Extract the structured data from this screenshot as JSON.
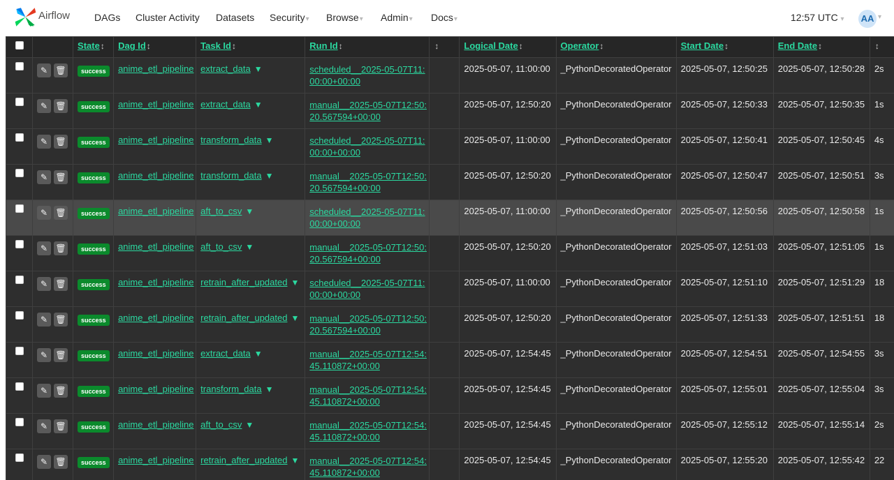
{
  "nav": {
    "brand": "Airflow",
    "items": [
      {
        "label": "DAGs",
        "dropdown": false
      },
      {
        "label": "Cluster Activity",
        "dropdown": false
      },
      {
        "label": "Datasets",
        "dropdown": false
      },
      {
        "label": "Security",
        "dropdown": true
      },
      {
        "label": "Browse",
        "dropdown": true
      },
      {
        "label": "Admin",
        "dropdown": true
      },
      {
        "label": "Docs",
        "dropdown": true
      }
    ],
    "clock": "12:57 UTC",
    "avatar": "AA"
  },
  "table": {
    "headers": {
      "state": "State",
      "dag_id": "Dag Id",
      "task_id": "Task Id",
      "run_id": "Run Id",
      "logical_date": "Logical Date",
      "operator": "Operator",
      "start_date": "Start Date",
      "end_date": "End Date"
    },
    "rows": [
      {
        "state": "success",
        "dag_id": "anime_etl_pipeline",
        "task_id": "extract_data",
        "run_id": "scheduled__2025-05-07T11:00:00+00:00",
        "logical_date": "2025-05-07, 11:00:00",
        "operator": "_PythonDecoratedOperator",
        "start_date": "2025-05-07, 12:50:25",
        "end_date": "2025-05-07, 12:50:28",
        "duration": "2s"
      },
      {
        "state": "success",
        "dag_id": "anime_etl_pipeline",
        "task_id": "extract_data",
        "run_id": "manual__2025-05-07T12:50:20.567594+00:00",
        "logical_date": "2025-05-07, 12:50:20",
        "operator": "_PythonDecoratedOperator",
        "start_date": "2025-05-07, 12:50:33",
        "end_date": "2025-05-07, 12:50:35",
        "duration": "1s"
      },
      {
        "state": "success",
        "dag_id": "anime_etl_pipeline",
        "task_id": "transform_data",
        "run_id": "scheduled__2025-05-07T11:00:00+00:00",
        "logical_date": "2025-05-07, 11:00:00",
        "operator": "_PythonDecoratedOperator",
        "start_date": "2025-05-07, 12:50:41",
        "end_date": "2025-05-07, 12:50:45",
        "duration": "4s"
      },
      {
        "state": "success",
        "dag_id": "anime_etl_pipeline",
        "task_id": "transform_data",
        "run_id": "manual__2025-05-07T12:50:20.567594+00:00",
        "logical_date": "2025-05-07, 12:50:20",
        "operator": "_PythonDecoratedOperator",
        "start_date": "2025-05-07, 12:50:47",
        "end_date": "2025-05-07, 12:50:51",
        "duration": "3s"
      },
      {
        "state": "success",
        "dag_id": "anime_etl_pipeline",
        "task_id": "aft_to_csv",
        "run_id": "scheduled__2025-05-07T11:00:00+00:00",
        "logical_date": "2025-05-07, 11:00:00",
        "operator": "_PythonDecoratedOperator",
        "start_date": "2025-05-07, 12:50:56",
        "end_date": "2025-05-07, 12:50:58",
        "duration": "1s",
        "highlight": true
      },
      {
        "state": "success",
        "dag_id": "anime_etl_pipeline",
        "task_id": "aft_to_csv",
        "run_id": "manual__2025-05-07T12:50:20.567594+00:00",
        "logical_date": "2025-05-07, 12:50:20",
        "operator": "_PythonDecoratedOperator",
        "start_date": "2025-05-07, 12:51:03",
        "end_date": "2025-05-07, 12:51:05",
        "duration": "1s"
      },
      {
        "state": "success",
        "dag_id": "anime_etl_pipeline",
        "task_id": "retrain_after_updated",
        "run_id": "scheduled__2025-05-07T11:00:00+00:00",
        "logical_date": "2025-05-07, 11:00:00",
        "operator": "_PythonDecoratedOperator",
        "start_date": "2025-05-07, 12:51:10",
        "end_date": "2025-05-07, 12:51:29",
        "duration": "18"
      },
      {
        "state": "success",
        "dag_id": "anime_etl_pipeline",
        "task_id": "retrain_after_updated",
        "run_id": "manual__2025-05-07T12:50:20.567594+00:00",
        "logical_date": "2025-05-07, 12:50:20",
        "operator": "_PythonDecoratedOperator",
        "start_date": "2025-05-07, 12:51:33",
        "end_date": "2025-05-07, 12:51:51",
        "duration": "18"
      },
      {
        "state": "success",
        "dag_id": "anime_etl_pipeline",
        "task_id": "extract_data",
        "run_id": "manual__2025-05-07T12:54:45.110872+00:00",
        "logical_date": "2025-05-07, 12:54:45",
        "operator": "_PythonDecoratedOperator",
        "start_date": "2025-05-07, 12:54:51",
        "end_date": "2025-05-07, 12:54:55",
        "duration": "3s"
      },
      {
        "state": "success",
        "dag_id": "anime_etl_pipeline",
        "task_id": "transform_data",
        "run_id": "manual__2025-05-07T12:54:45.110872+00:00",
        "logical_date": "2025-05-07, 12:54:45",
        "operator": "_PythonDecoratedOperator",
        "start_date": "2025-05-07, 12:55:01",
        "end_date": "2025-05-07, 12:55:04",
        "duration": "3s"
      },
      {
        "state": "success",
        "dag_id": "anime_etl_pipeline",
        "task_id": "aft_to_csv",
        "run_id": "manual__2025-05-07T12:54:45.110872+00:00",
        "logical_date": "2025-05-07, 12:54:45",
        "operator": "_PythonDecoratedOperator",
        "start_date": "2025-05-07, 12:55:12",
        "end_date": "2025-05-07, 12:55:14",
        "duration": "2s"
      },
      {
        "state": "success",
        "dag_id": "anime_etl_pipeline",
        "task_id": "retrain_after_updated",
        "run_id": "manual__2025-05-07T12:54:45.110872+00:00",
        "logical_date": "2025-05-07, 12:54:45",
        "operator": "_PythonDecoratedOperator",
        "start_date": "2025-05-07, 12:55:20",
        "end_date": "2025-05-07, 12:55:42",
        "duration": "22"
      }
    ]
  },
  "icons": {
    "edit": "edit-icon",
    "delete": "trash-icon",
    "filter": "filter-icon",
    "sort": "sort-icon"
  },
  "colors": {
    "link": "#2bd9a0",
    "success": "#0b8a2c",
    "table_bg": "#2e2e2e",
    "highlight_row": "#4a4a4a"
  }
}
